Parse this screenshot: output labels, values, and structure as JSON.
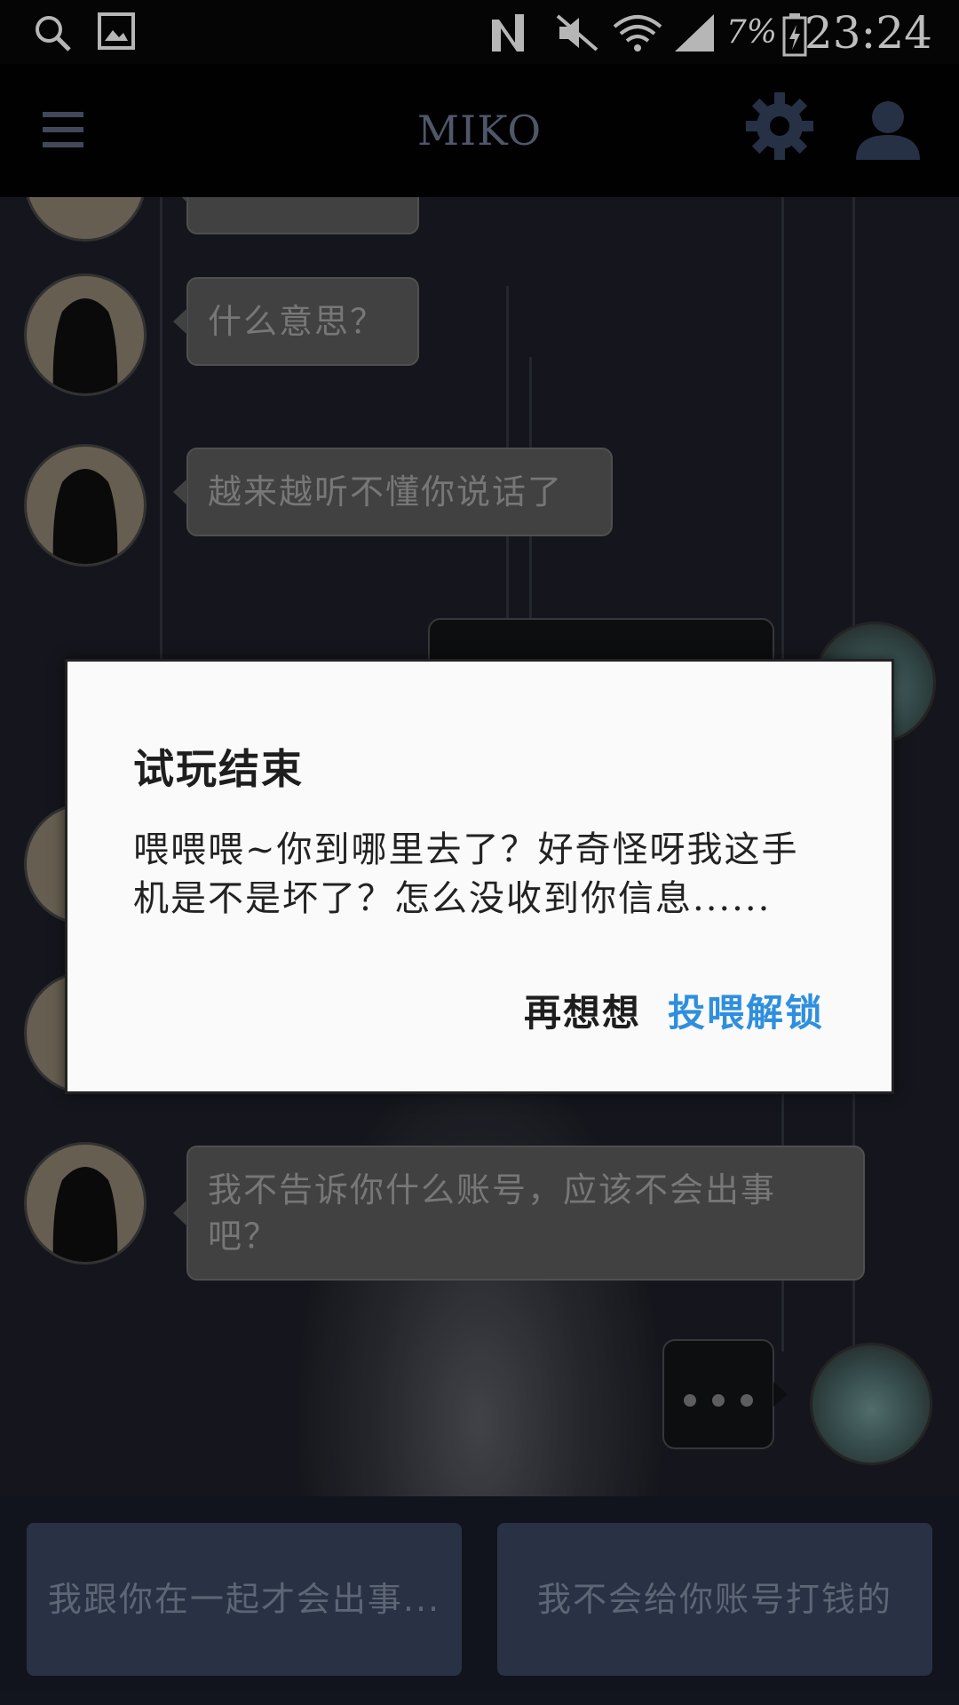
{
  "status_bar": {
    "time": "23:24",
    "battery_percent": "7%",
    "icons": [
      "search-icon",
      "image-icon",
      "nfc-icon",
      "mute-icon",
      "wifi-icon",
      "signal-icon",
      "battery-icon"
    ]
  },
  "header": {
    "title": "MIKO",
    "icons": [
      "menu-icon",
      "settings-gear-icon",
      "profile-icon"
    ]
  },
  "messages": [
    {
      "sender": "miko",
      "text": ""
    },
    {
      "sender": "miko",
      "text": "什么意思？"
    },
    {
      "sender": "miko",
      "text": "越来越听不懂你说话了"
    },
    {
      "sender": "user",
      "text": ""
    },
    {
      "sender": "miko",
      "text": ""
    },
    {
      "sender": "miko",
      "text": ""
    },
    {
      "sender": "miko",
      "text": "我不告诉你什么账号，应该不会出事吧？"
    },
    {
      "sender": "user",
      "text": "typing-indicator"
    }
  ],
  "choices": [
    {
      "label": "我跟你在一起才会出事..."
    },
    {
      "label": "我不会给你账号打钱的"
    }
  ],
  "dialog": {
    "title": "试玩结束",
    "message": "喂喂喂~你到哪里去了？好奇怪呀我这手机是不是坏了？怎么没收到你信息......",
    "cancel_label": "再想想",
    "confirm_label": "投喂解锁"
  },
  "colors": {
    "accent": "#2f8fde",
    "bubble": "#4b4b4c",
    "choice": "#2f384e"
  }
}
